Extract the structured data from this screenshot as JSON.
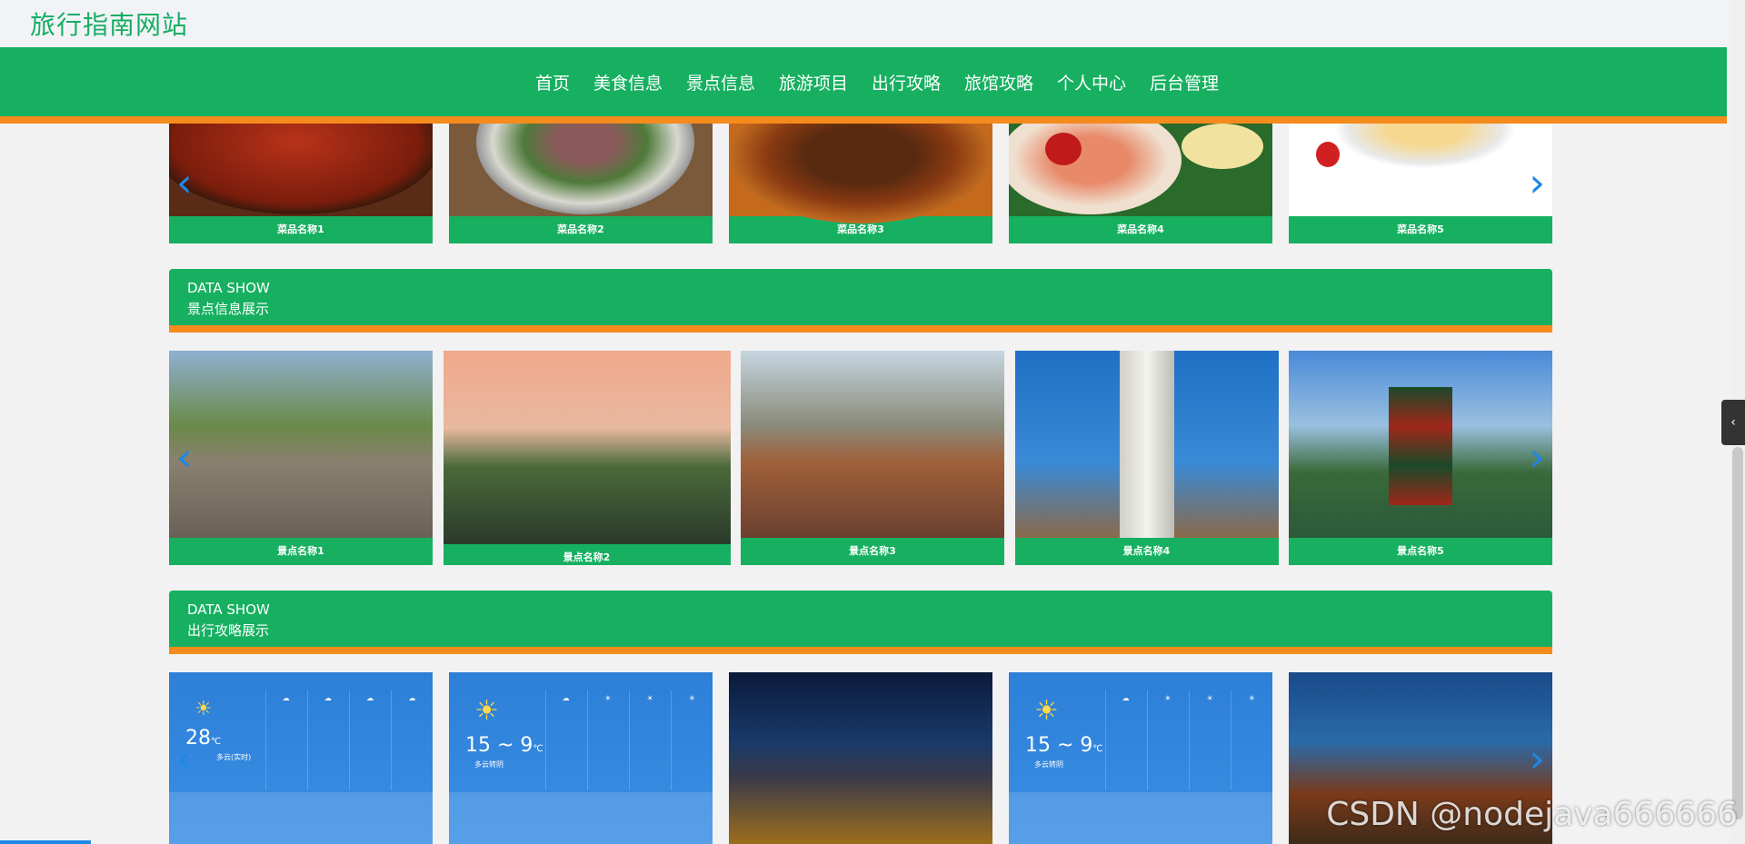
{
  "site": {
    "title": "旅行指南网站"
  },
  "nav": {
    "items": [
      "首页",
      "美食信息",
      "景点信息",
      "旅游项目",
      "出行攻略",
      "旅馆攻略",
      "个人中心",
      "后台管理"
    ]
  },
  "food": {
    "items": [
      "菜品名称1",
      "菜品名称2",
      "菜品名称3",
      "菜品名称4",
      "菜品名称5"
    ]
  },
  "spots_section": {
    "en": "DATA SHOW",
    "cn": "景点信息展示"
  },
  "spots": {
    "items": [
      "景点名称1",
      "景点名称2",
      "景点名称3",
      "景点名称4",
      "景点名称5"
    ]
  },
  "guides_section": {
    "en": "DATA SHOW",
    "cn": "出行攻略展示"
  },
  "weather": {
    "card1": {
      "temp": "28",
      "unit": "℃",
      "desc": "多云(实时)"
    },
    "card2": {
      "temp": "15 ~ 9",
      "unit": "℃",
      "desc": "多云转阴"
    },
    "card4": {
      "temp": "15 ~ 9",
      "unit": "℃",
      "desc": "多云转阴"
    }
  },
  "watermark": "CSDN @nodejava666666",
  "icons": {
    "arrow_left": "‹",
    "arrow_right": "›",
    "side_tab": "‹"
  },
  "colors": {
    "primary_green": "#17b061",
    "accent_orange": "#f58a1d",
    "arrow_blue": "#1e88e5"
  }
}
